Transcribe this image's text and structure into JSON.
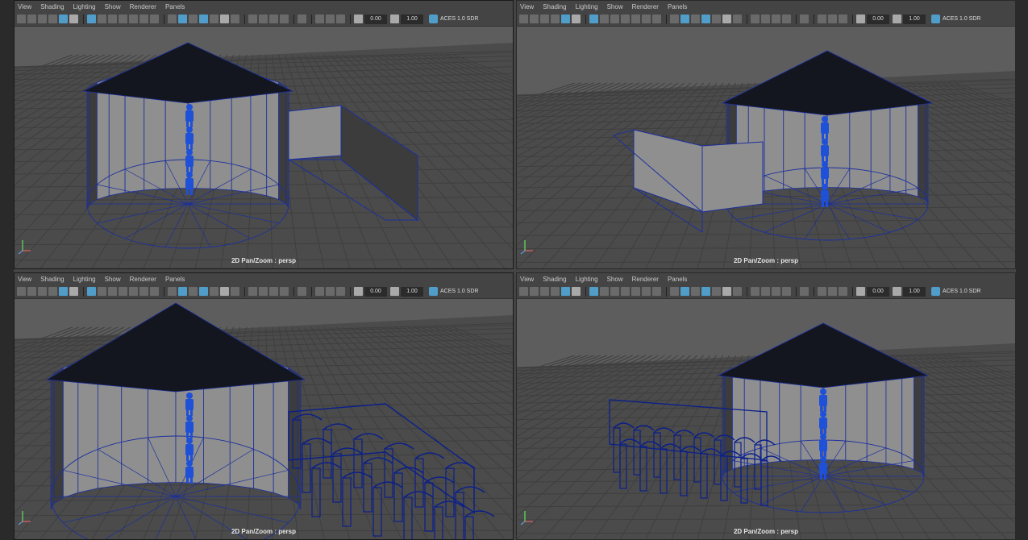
{
  "menus": [
    "View",
    "Shading",
    "Lighting",
    "Show",
    "Renderer",
    "Panels"
  ],
  "toolbar": {
    "exposure_value": "0.00",
    "gamma_value": "1.00",
    "color_space_label": "ACES 1.0 SDR"
  },
  "panels": [
    {
      "camera_label": "2D Pan/Zoom : persp"
    },
    {
      "camera_label": "2D Pan/Zoom : persp"
    },
    {
      "camera_label": "2D Pan/Zoom : persp"
    },
    {
      "camera_label": "2D Pan/Zoom : persp"
    }
  ],
  "colors": {
    "viewport_bg": "#5d5d5d",
    "wire_blue": "#1b2f9e",
    "roof": "#14161f",
    "wall_light": "#8f8f8f",
    "wall_dark": "#3c3c3c",
    "grid": "#3f3f3f",
    "highlight": "#4f9dc8"
  }
}
